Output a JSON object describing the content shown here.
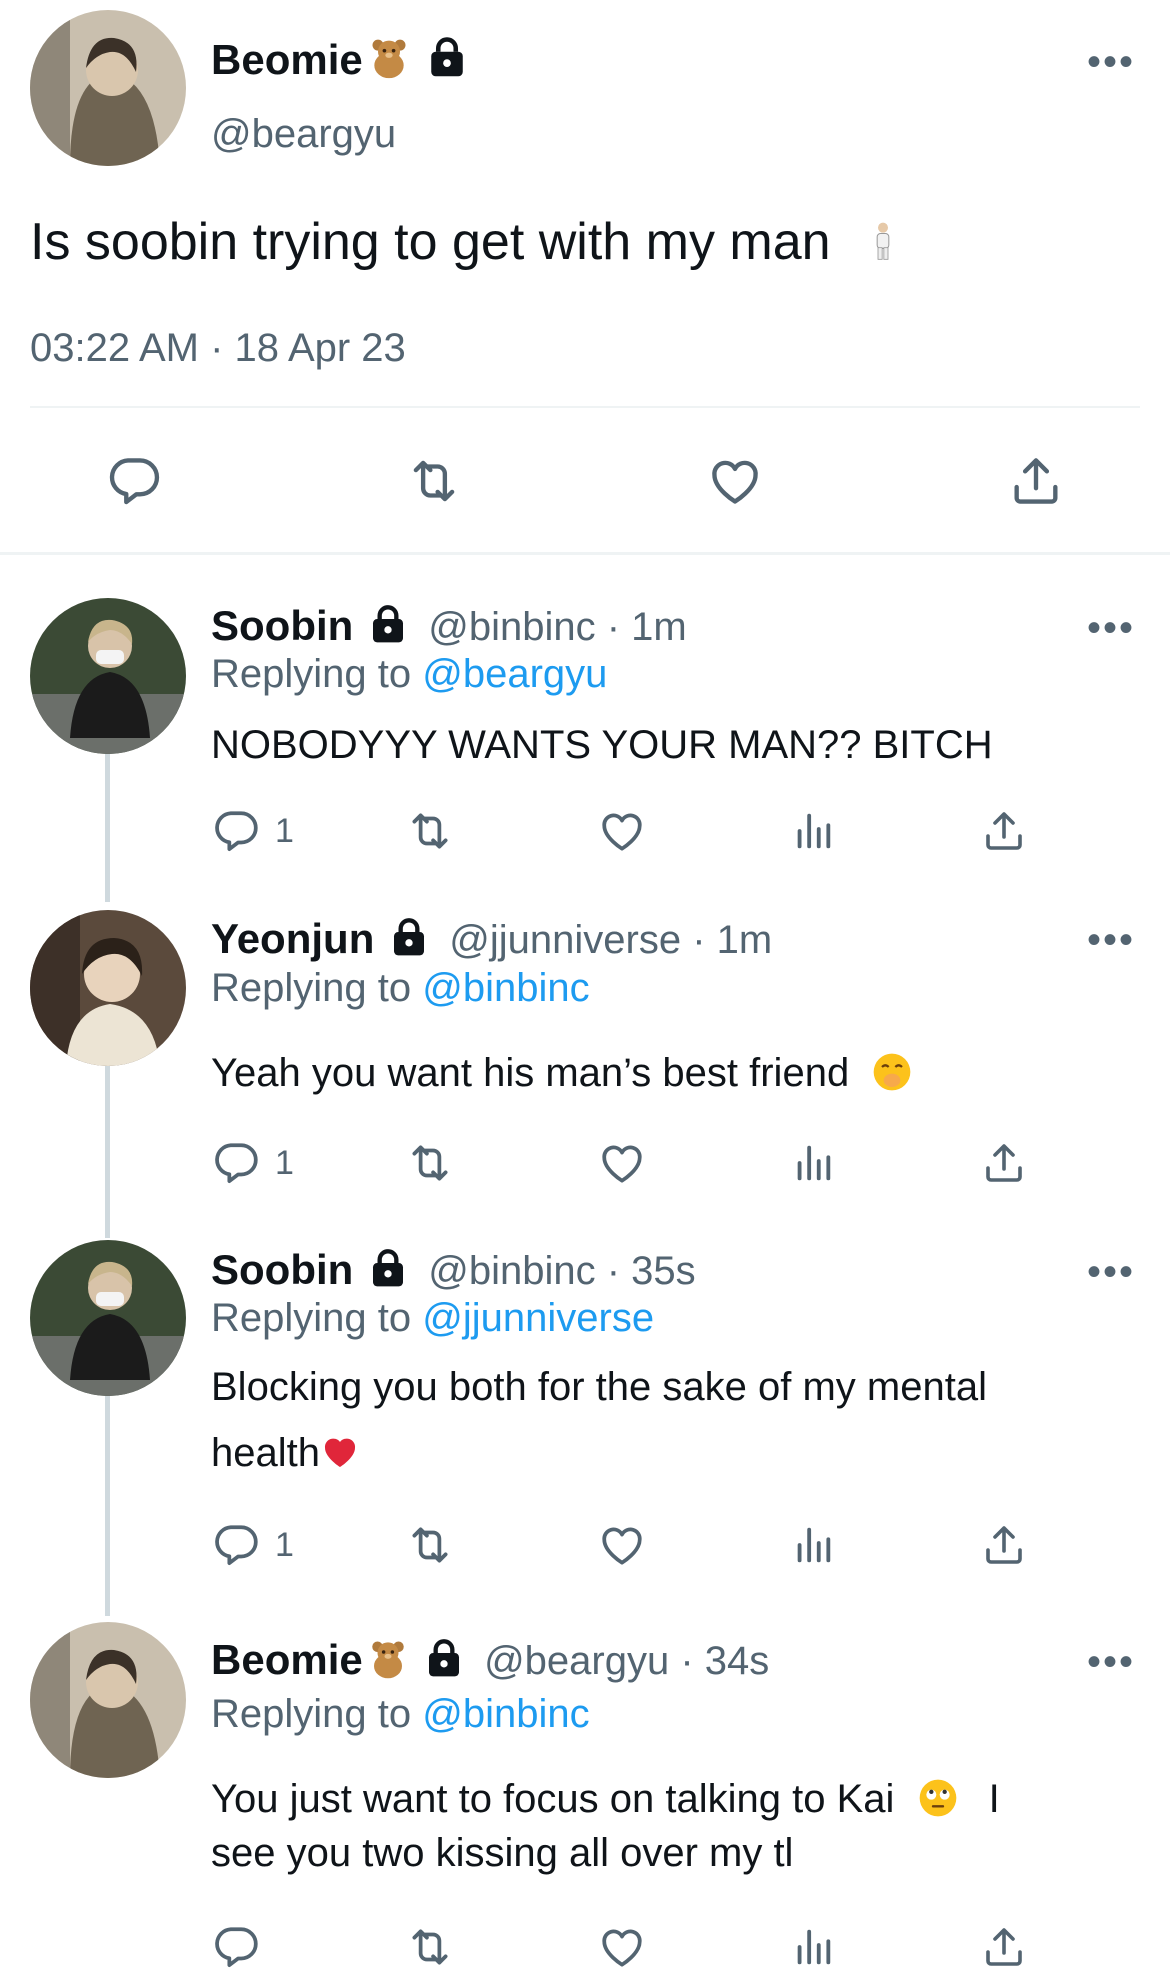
{
  "main_tweet": {
    "name": "Beomie",
    "handle": "@beargyu",
    "text": "Is soobin trying to get with my man",
    "timestamp": "03:22 AM · 18 Apr 23",
    "emojis": [
      "teddy-bear",
      "standing-person"
    ]
  },
  "replies": [
    {
      "name": "Soobin",
      "meta": "@binbinc · 1m",
      "replying_label": "Replying to",
      "replying_to": "@beargyu",
      "text": "NOBODYYY WANTS YOUR MAN?? BITCH",
      "reply_count": "1"
    },
    {
      "name": "Yeonjun",
      "meta": "@jjunniverse · 1m",
      "replying_label": "Replying to",
      "replying_to": "@binbinc",
      "text": "Yeah you want his man’s best friend",
      "reply_count": "1",
      "emoji": "face-with-hand-over-mouth"
    },
    {
      "name": "Soobin",
      "meta": "@binbinc · 35s",
      "replying_label": "Replying to",
      "replying_to": "@jjunniverse",
      "text_line1": "Blocking you both for the sake of my mental",
      "text_line2": "health",
      "reply_count": "1",
      "emoji": "red-heart"
    },
    {
      "name": "Beomie",
      "meta": "@beargyu · 34s",
      "replying_label": "Replying to",
      "replying_to": "@binbinc",
      "text_line1a": "You just want to focus on talking to Kai",
      "text_line1b": "I",
      "text_line2": "see you two kissing all over my tl",
      "emoji": "face-with-rolling-eyes"
    }
  ],
  "colors": {
    "text": "#0f1419",
    "secondary": "#536471",
    "accent": "#1d9bf0",
    "divider": "#eff3f4",
    "thread_line": "#cfd9de"
  }
}
